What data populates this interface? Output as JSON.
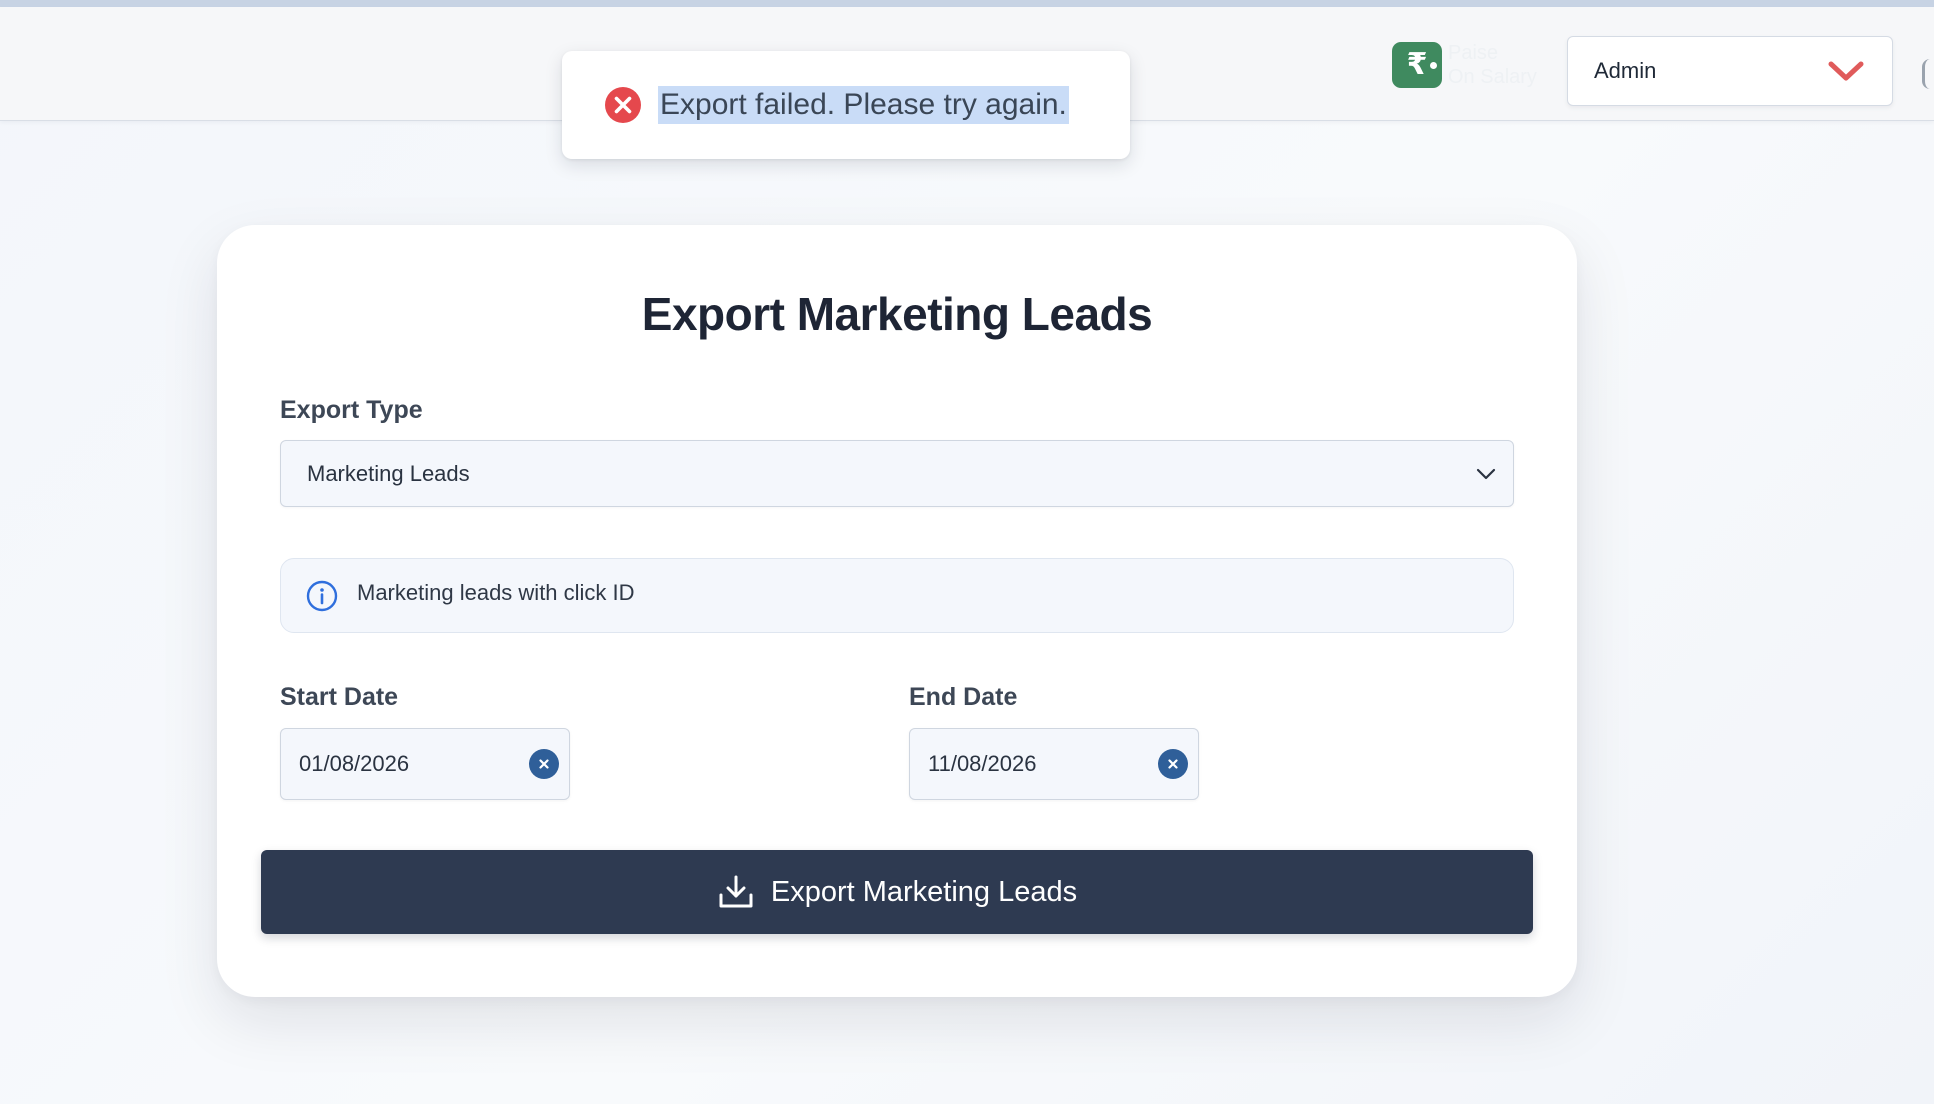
{
  "header": {
    "brand_logo_symbol": "₹",
    "brand_name_line1": "Paise",
    "brand_name_line2": "On Salary",
    "role_selector": {
      "value": "Admin",
      "chevron_color": "#e05b5b"
    }
  },
  "toast": {
    "type": "error",
    "icon": "error-circle-x-icon",
    "message": "Export failed. Please try again.",
    "icon_color": "#e5484d"
  },
  "form": {
    "title": "Export Marketing Leads",
    "export_type": {
      "label": "Export Type",
      "selected": "Marketing Leads"
    },
    "info": {
      "icon": "info-icon",
      "text": "Marketing leads with click ID"
    },
    "start_date": {
      "label": "Start Date",
      "value": "01/08/2026"
    },
    "end_date": {
      "label": "End Date",
      "value": "11/08/2026"
    },
    "submit": {
      "icon": "download-icon",
      "label": "Export Marketing Leads",
      "color": "#2e3a51"
    }
  },
  "colors": {
    "accent_blue": "#2f5f99",
    "brand_green": "#3f8a5f",
    "highlight": "#c9dcf7"
  }
}
